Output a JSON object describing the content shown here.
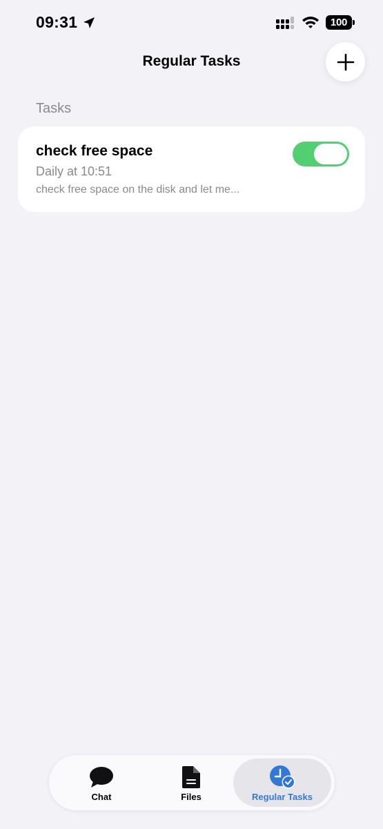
{
  "status_bar": {
    "time": "09:31",
    "battery": "100",
    "icons": [
      "location-arrow-icon",
      "cellular-signal-icon",
      "wifi-icon",
      "battery-icon"
    ]
  },
  "header": {
    "title": "Regular Tasks",
    "add_icon": "plus-icon"
  },
  "section": {
    "title": "Tasks"
  },
  "tasks": [
    {
      "title": "check free space",
      "schedule": "Daily at 10:51",
      "description": "check free space on the disk and let me...",
      "enabled": true
    }
  ],
  "tab_bar": {
    "items": [
      {
        "label": "Chat",
        "icon": "chat-bubble-icon",
        "active": false
      },
      {
        "label": "Files",
        "icon": "document-icon",
        "active": false
      },
      {
        "label": "Regular Tasks",
        "icon": "clock-check-icon",
        "active": true
      }
    ]
  },
  "colors": {
    "background": "#f2f2f7",
    "toggle_on": "#34c759",
    "accent": "#3478d6",
    "secondary_text": "#8a8a8e"
  }
}
